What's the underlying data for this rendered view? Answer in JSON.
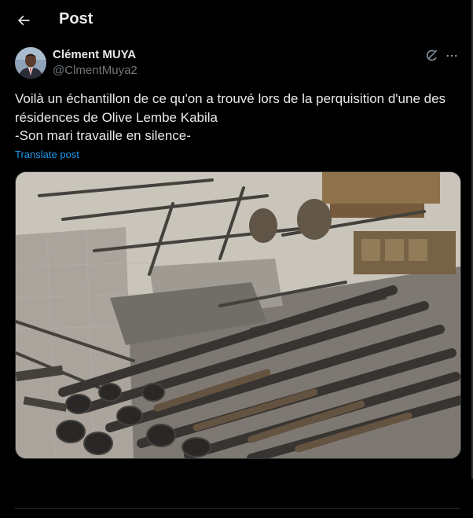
{
  "header": {
    "back_icon": "arrow-left-icon",
    "title": "Post"
  },
  "post": {
    "author": {
      "name": "Clément MUYA",
      "handle": "@ClmentMuya2",
      "avatar_icon": "user-avatar"
    },
    "actions": {
      "grok_icon": "grok-icon",
      "more_icon": "more-horizontal-icon"
    },
    "text_lines": [
      "Voilà un échantillon de ce qu'on a trouvé lors de la perquisition d'une des",
      "résidences de Olive Lembe Kabila",
      "-Son mari travaille en silence-"
    ],
    "translate_label": "Translate post",
    "media": {
      "type": "photo"
    }
  },
  "colors": {
    "background": "#000000",
    "text_primary": "#e7e9ea",
    "text_secondary": "#71767b",
    "link": "#1d9bf0",
    "border": "#2f3336"
  }
}
